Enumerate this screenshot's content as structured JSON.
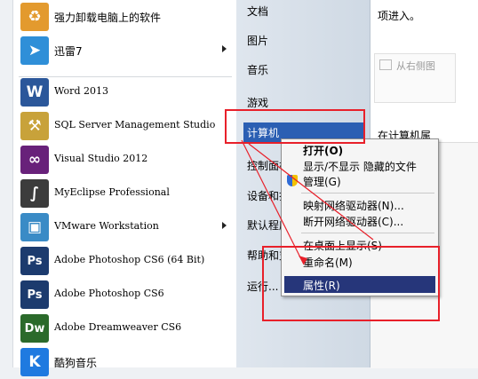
{
  "programs": [
    {
      "label": "强力卸载电脑上的软件",
      "icon": "uninstall-icon",
      "icon_text": "♻",
      "color": "#e39a2e",
      "arrow": false
    },
    {
      "label": "迅雷7",
      "icon": "thunder-bird-icon",
      "icon_text": "➤",
      "color": "#2f8fd8",
      "arrow": true
    },
    {
      "label": "Word 2013",
      "icon": "word-icon",
      "icon_text": "W",
      "color": "#2b579a",
      "arrow": false
    },
    {
      "label": "SQL Server Management Studio",
      "icon": "sql-server-icon",
      "icon_text": "⚒",
      "color": "#c8a23a",
      "arrow": false
    },
    {
      "label": "Visual Studio 2012",
      "icon": "visual-studio-icon",
      "icon_text": "∞",
      "color": "#68217a",
      "arrow": false
    },
    {
      "label": "MyEclipse Professional",
      "icon": "myeclipse-icon",
      "icon_text": "∫",
      "color": "#3c3c3c",
      "arrow": false
    },
    {
      "label": "VMware Workstation",
      "icon": "vmware-icon",
      "icon_text": "▣",
      "color": "#3a8bc6",
      "arrow": true
    },
    {
      "label": "Adobe Photoshop CS6 (64 Bit)",
      "icon": "photoshop-icon",
      "icon_text": "Ps",
      "color": "#1c3b6e",
      "arrow": false
    },
    {
      "label": "Adobe Photoshop CS6",
      "icon": "photoshop-icon",
      "icon_text": "Ps",
      "color": "#1c3b6e",
      "arrow": false
    },
    {
      "label": "Adobe Dreamweaver CS6",
      "icon": "dreamweaver-icon",
      "icon_text": "Dw",
      "color": "#2b6a2b",
      "arrow": false
    },
    {
      "label": "酷狗音乐",
      "icon": "kugou-icon",
      "icon_text": "K",
      "color": "#1f7ae0",
      "arrow": false
    }
  ],
  "right_menu": {
    "documents": "文档",
    "pictures": "图片",
    "music": "音乐",
    "games": "游戏",
    "computer": "计算机",
    "control_panel": "控制面板",
    "devices": "设备和打印机",
    "default_programs": "默认程序",
    "help": "帮助和支持",
    "run": "运行..."
  },
  "context_menu": {
    "open": "打开(O)",
    "toggle": "显示/不显示 隐藏的文件",
    "manage": "管理(G)",
    "map_drive": "映射网络驱动器(N)...",
    "disconnect_drive": "断开网络驱动器(C)...",
    "show_on_desktop": "在桌面上显示(S)",
    "rename": "重命名(M)",
    "properties": "属性(R)"
  },
  "document": {
    "line1": "项进入。",
    "image_placeholder": "从右侧图",
    "line2": "在计算机属"
  }
}
